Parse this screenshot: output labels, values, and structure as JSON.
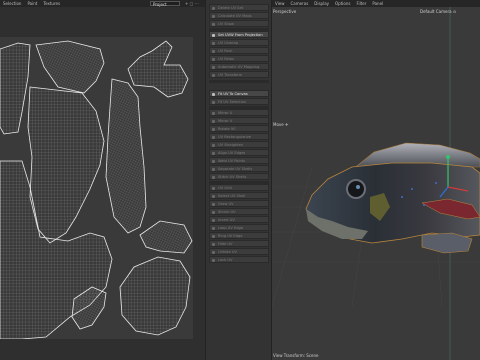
{
  "uv_menubar": {
    "items": [
      "Selection",
      "Paint",
      "Textures"
    ],
    "dropdown": "Project",
    "icons": "+ ▢ ⋯"
  },
  "sidebar": {
    "items": [
      {
        "label": "Delete UV Set",
        "active": false
      },
      {
        "label": "Calculate UV Maps",
        "active": false
      },
      {
        "label": "UV Show",
        "active": false
      },
      {
        "label": "Set UVW From Projection",
        "active": true
      },
      {
        "label": "UV Unwrap",
        "active": false
      },
      {
        "label": "UV Pack",
        "active": false
      },
      {
        "label": "UV Relax",
        "active": false
      },
      {
        "label": "Automatic UV Mapping",
        "active": false
      },
      {
        "label": "UV Transform",
        "active": false
      },
      {
        "label": "Fit UV To Canvas",
        "active": true
      },
      {
        "label": "Fit UV Selection",
        "active": false
      },
      {
        "label": "Mirror U",
        "active": false
      },
      {
        "label": "Mirror V",
        "active": false
      },
      {
        "label": "Rotate 90",
        "active": false
      },
      {
        "label": "UV Rectangularize",
        "active": false
      },
      {
        "label": "UV Straighten",
        "active": false
      },
      {
        "label": "Align UV Edges",
        "active": false
      },
      {
        "label": "Weld UV Points",
        "active": false
      },
      {
        "label": "Separate UV Shells",
        "active": false
      },
      {
        "label": "Stitch UV Shells",
        "active": false
      },
      {
        "label": "UV Grid",
        "active": false
      },
      {
        "label": "Select UV Shell",
        "active": false
      },
      {
        "label": "Grow UV",
        "active": false
      },
      {
        "label": "Shrink UV",
        "active": false
      },
      {
        "label": "Invert UV",
        "active": false
      },
      {
        "label": "Loop UV Edge",
        "active": false
      },
      {
        "label": "Ring UV Edge",
        "active": false
      },
      {
        "label": "Hide UV",
        "active": false
      },
      {
        "label": "Unhide UV",
        "active": false
      },
      {
        "label": "Lock UV",
        "active": false
      }
    ]
  },
  "viewport": {
    "menu": [
      "View",
      "Cameras",
      "Display",
      "Options",
      "Filter",
      "Panel"
    ],
    "label_view": "Perspective",
    "label_camera": "Default Camera ⊙",
    "label_move": "Move ✛",
    "label_transform": "View Transform: Scene"
  }
}
